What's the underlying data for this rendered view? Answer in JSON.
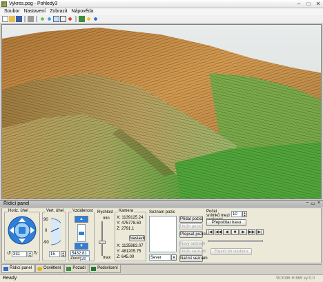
{
  "window": {
    "title": "Vykres.pog - Pohledy3",
    "buttons": [
      "–",
      "□",
      "✕"
    ]
  },
  "menu": [
    "Soubor",
    "Nastavení",
    "Zobrazit",
    "Nápověda"
  ],
  "toolbar": {
    "icons": [
      "new-icon",
      "open-icon",
      "save-icon",
      "print-icon",
      "zoom-in-icon",
      "zoom-out-icon",
      "view-3d-icon",
      "view-front-icon",
      "rotate-icon",
      "color-icon",
      "light-icon",
      "help-icon"
    ]
  },
  "panel": {
    "title": "Řídící panel",
    "title_buttons": [
      "−",
      "▭",
      "×"
    ],
    "horiz": {
      "label": "Horiz. úhel",
      "value": "331"
    },
    "vert": {
      "label": "Vert. úhel",
      "ticks": [
        "90",
        "0",
        "-90"
      ],
      "value": "15"
    },
    "distance": {
      "label": "Vzdálenost",
      "value": "5432.81",
      "zoom_label": "Zoom",
      "zoom_value": "20"
    },
    "speed": {
      "label": "Rychlost",
      "min": "min",
      "max": "max"
    },
    "camera": {
      "label": "Kamera",
      "x": "X: 1139125.24",
      "y": "Y: 475778.50",
      "z": "Z: 2791.1",
      "set_button": "Nastavit",
      "tx": "X: 1135883.07",
      "ty": "Y: 481205.75",
      "tz": "Z: 645.00"
    },
    "positions": {
      "label": "Seznam pozic",
      "direction": "Sever",
      "buttons": [
        "Přidat pozici",
        "Uložit pozici",
        "Přepsat pozici",
        "Nový seznam",
        "Uložit seznam",
        "Načíst seznam"
      ],
      "disabled": [
        false,
        true,
        false,
        true,
        true,
        false
      ]
    },
    "route": {
      "count_label": "Počet snímků mezi pozicemi",
      "count_value": "10",
      "recalc_button": "Přepočítat trasu",
      "export_button": "Export do souboru",
      "player": [
        "|◀",
        "◀◀",
        "◀",
        "■",
        "▶",
        "▶▶",
        "▶|"
      ]
    }
  },
  "tabs": [
    {
      "label": "Řídící panel",
      "icon": "panel-icon",
      "color": "#2e6bd8",
      "active": true
    },
    {
      "label": "Osvětlení",
      "icon": "light-icon",
      "color": "#e0b21a",
      "active": false
    },
    {
      "label": "Pozadí",
      "icon": "background-icon",
      "color": "#3a8f3a",
      "active": false
    },
    {
      "label": "Podsvícení",
      "icon": "backlight-icon",
      "color": "#1f7a3a",
      "active": false
    }
  ],
  "status": {
    "text": "Ready",
    "right": "W:3096  H:669     xy:0.0"
  },
  "colors": {
    "terrain_high": "#c8893c",
    "terrain_mid": "#b9a055",
    "terrain_low": "#58a83a",
    "accent": "#2e6bd8"
  }
}
